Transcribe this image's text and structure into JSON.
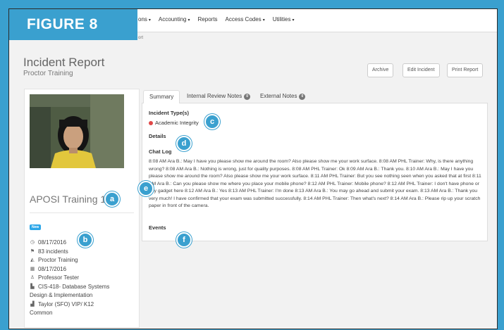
{
  "figure_label": "FIGURE 8",
  "nav": {
    "items": [
      {
        "label": "ons",
        "has_caret": true
      },
      {
        "label": "Accounting",
        "has_caret": true
      },
      {
        "label": "Reports",
        "has_caret": false
      },
      {
        "label": "Access Codes",
        "has_caret": true
      },
      {
        "label": "Utilities",
        "has_caret": true
      }
    ],
    "caret_glyph": "▾"
  },
  "breadcrumb": "ort",
  "page": {
    "title": "Incident Report",
    "subtitle": "Proctor Training"
  },
  "actions": {
    "archive": "Archive",
    "edit": "Edit Incident",
    "print": "Print Report"
  },
  "profile": {
    "name": "APOSI Training 1",
    "badge": "New",
    "date": "08/17/2016",
    "incidents": "83 incidents",
    "exam": "Proctor Training",
    "exam_date": "08/17/2016",
    "instructor": "Professor Tester",
    "course_line1": "CIS-418- Database Systems",
    "course_line2": "Design & Implementation",
    "institution_line1": "Taylor (SFO) VIP/ K12",
    "institution_line2": "Common"
  },
  "tabs": {
    "summary": "Summary",
    "internal": "Internal Review Notes",
    "internal_count": "0",
    "external": "External Notes",
    "external_count": "0"
  },
  "summary": {
    "incident_types_heading": "Incident Type(s)",
    "incident_type": "Academic Integrity",
    "details_heading": "Details",
    "chat_log_heading": "Chat Log",
    "chat_log": "8:08 AM Ara B.: May I have you please show me around the room? Also please show me your work surface. 8:08 AM PHL Trainer: Why, is there anything wrong? 8:08 AM Ara B.: Nothing is wrong, just for quality purposes. 8:08 AM PHL Trainer: Ok 8:09 AM Ara B.: Thank you. 8:10 AM Ara B.: May I have you please show me around the room? Also please show me your work surface. 8:11 AM PHL Trainer: But you see nothing seen when you asked that at first 8:11 AM Ara B.: Can you please show me where you place your mobile phone? 8:12 AM PHL Trainer: Mobile phone? 8:12 AM PHL Trainer: I don't have phone or any gadget here 8:12 AM Ara B.: Yes 8:13 AM PHL Trainer: I'm done 8:13 AM Ara B.: You may go ahead and submit your exam. 8:13 AM Ara B.: Thank you very much! I have confirmed that your exam was submitted successfully. 8:14 AM PHL Trainer: Then what's next? 8:14 AM Ara B.: Please rip up your scratch paper in front of the camera.",
    "events_heading": "Events"
  },
  "callouts": {
    "a": "a",
    "b": "b",
    "c": "c",
    "d": "d",
    "e": "e",
    "f": "f"
  },
  "icons": {
    "date": "clock-icon",
    "incidents": "flag-icon",
    "exam": "graduation-cap-icon",
    "exam_date": "calendar-icon",
    "instructor": "person-icon",
    "course": "file-icon",
    "institution": "building-icon"
  },
  "colors": {
    "accent": "#3aa0cf",
    "badge": "#2ca6e8",
    "incident_dot": "#e04848"
  }
}
